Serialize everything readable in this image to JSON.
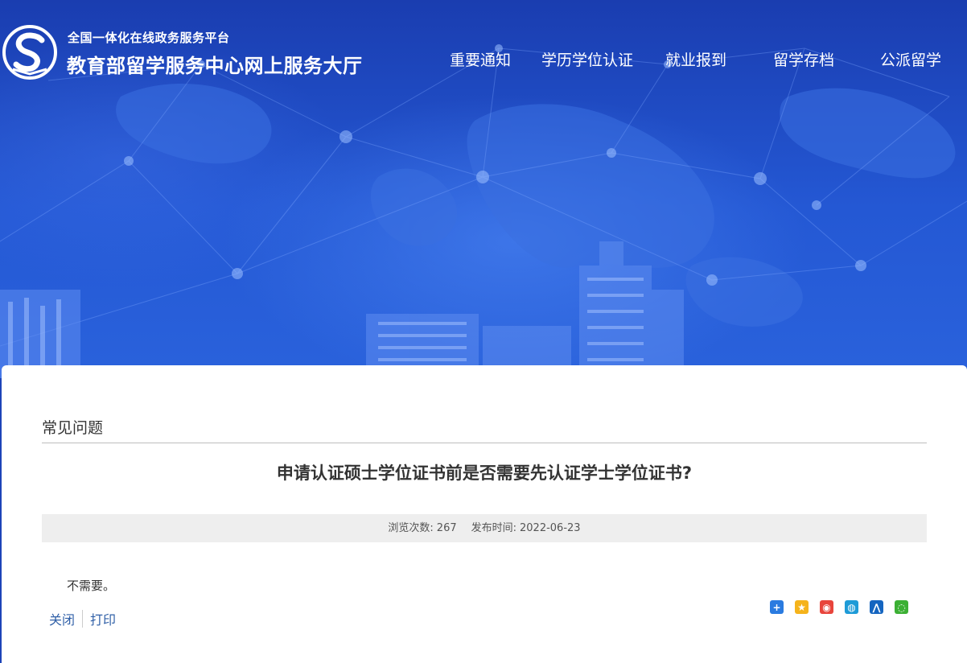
{
  "header": {
    "platform_subtitle": "全国一体化在线政务服务平台",
    "site_title": "教育部留学服务中心网上服务大厅",
    "nav": [
      {
        "label": "重要通知"
      },
      {
        "label": "学历学位认证"
      },
      {
        "label": "就业报到"
      },
      {
        "label": "留学存档"
      },
      {
        "label": "公派留学"
      }
    ]
  },
  "content": {
    "section_title": "常见问题",
    "article_title": "申请认证硕士学位证书前是否需要先认证学士学位证书?",
    "meta": {
      "views_label": "浏览次数:",
      "views_value": "267",
      "published_label": "发布时间:",
      "published_value": "2022-06-23"
    },
    "answer": "不需要。",
    "actions": {
      "close": "关闭",
      "print": "打印"
    }
  },
  "share": [
    {
      "icon": "share-more-icon",
      "color": "#2a7be0"
    },
    {
      "icon": "qzone-icon",
      "color": "#f5b31b"
    },
    {
      "icon": "weibo-icon",
      "color": "#e8453c"
    },
    {
      "icon": "tencent-weibo-icon",
      "color": "#1e9bd7"
    },
    {
      "icon": "renren-icon",
      "color": "#1565c0"
    },
    {
      "icon": "wechat-icon",
      "color": "#3cb034"
    }
  ],
  "colors": {
    "hero_blue": "#1d44b8",
    "link_blue": "#2f5fa7",
    "meta_bar": "#eeeeee"
  }
}
